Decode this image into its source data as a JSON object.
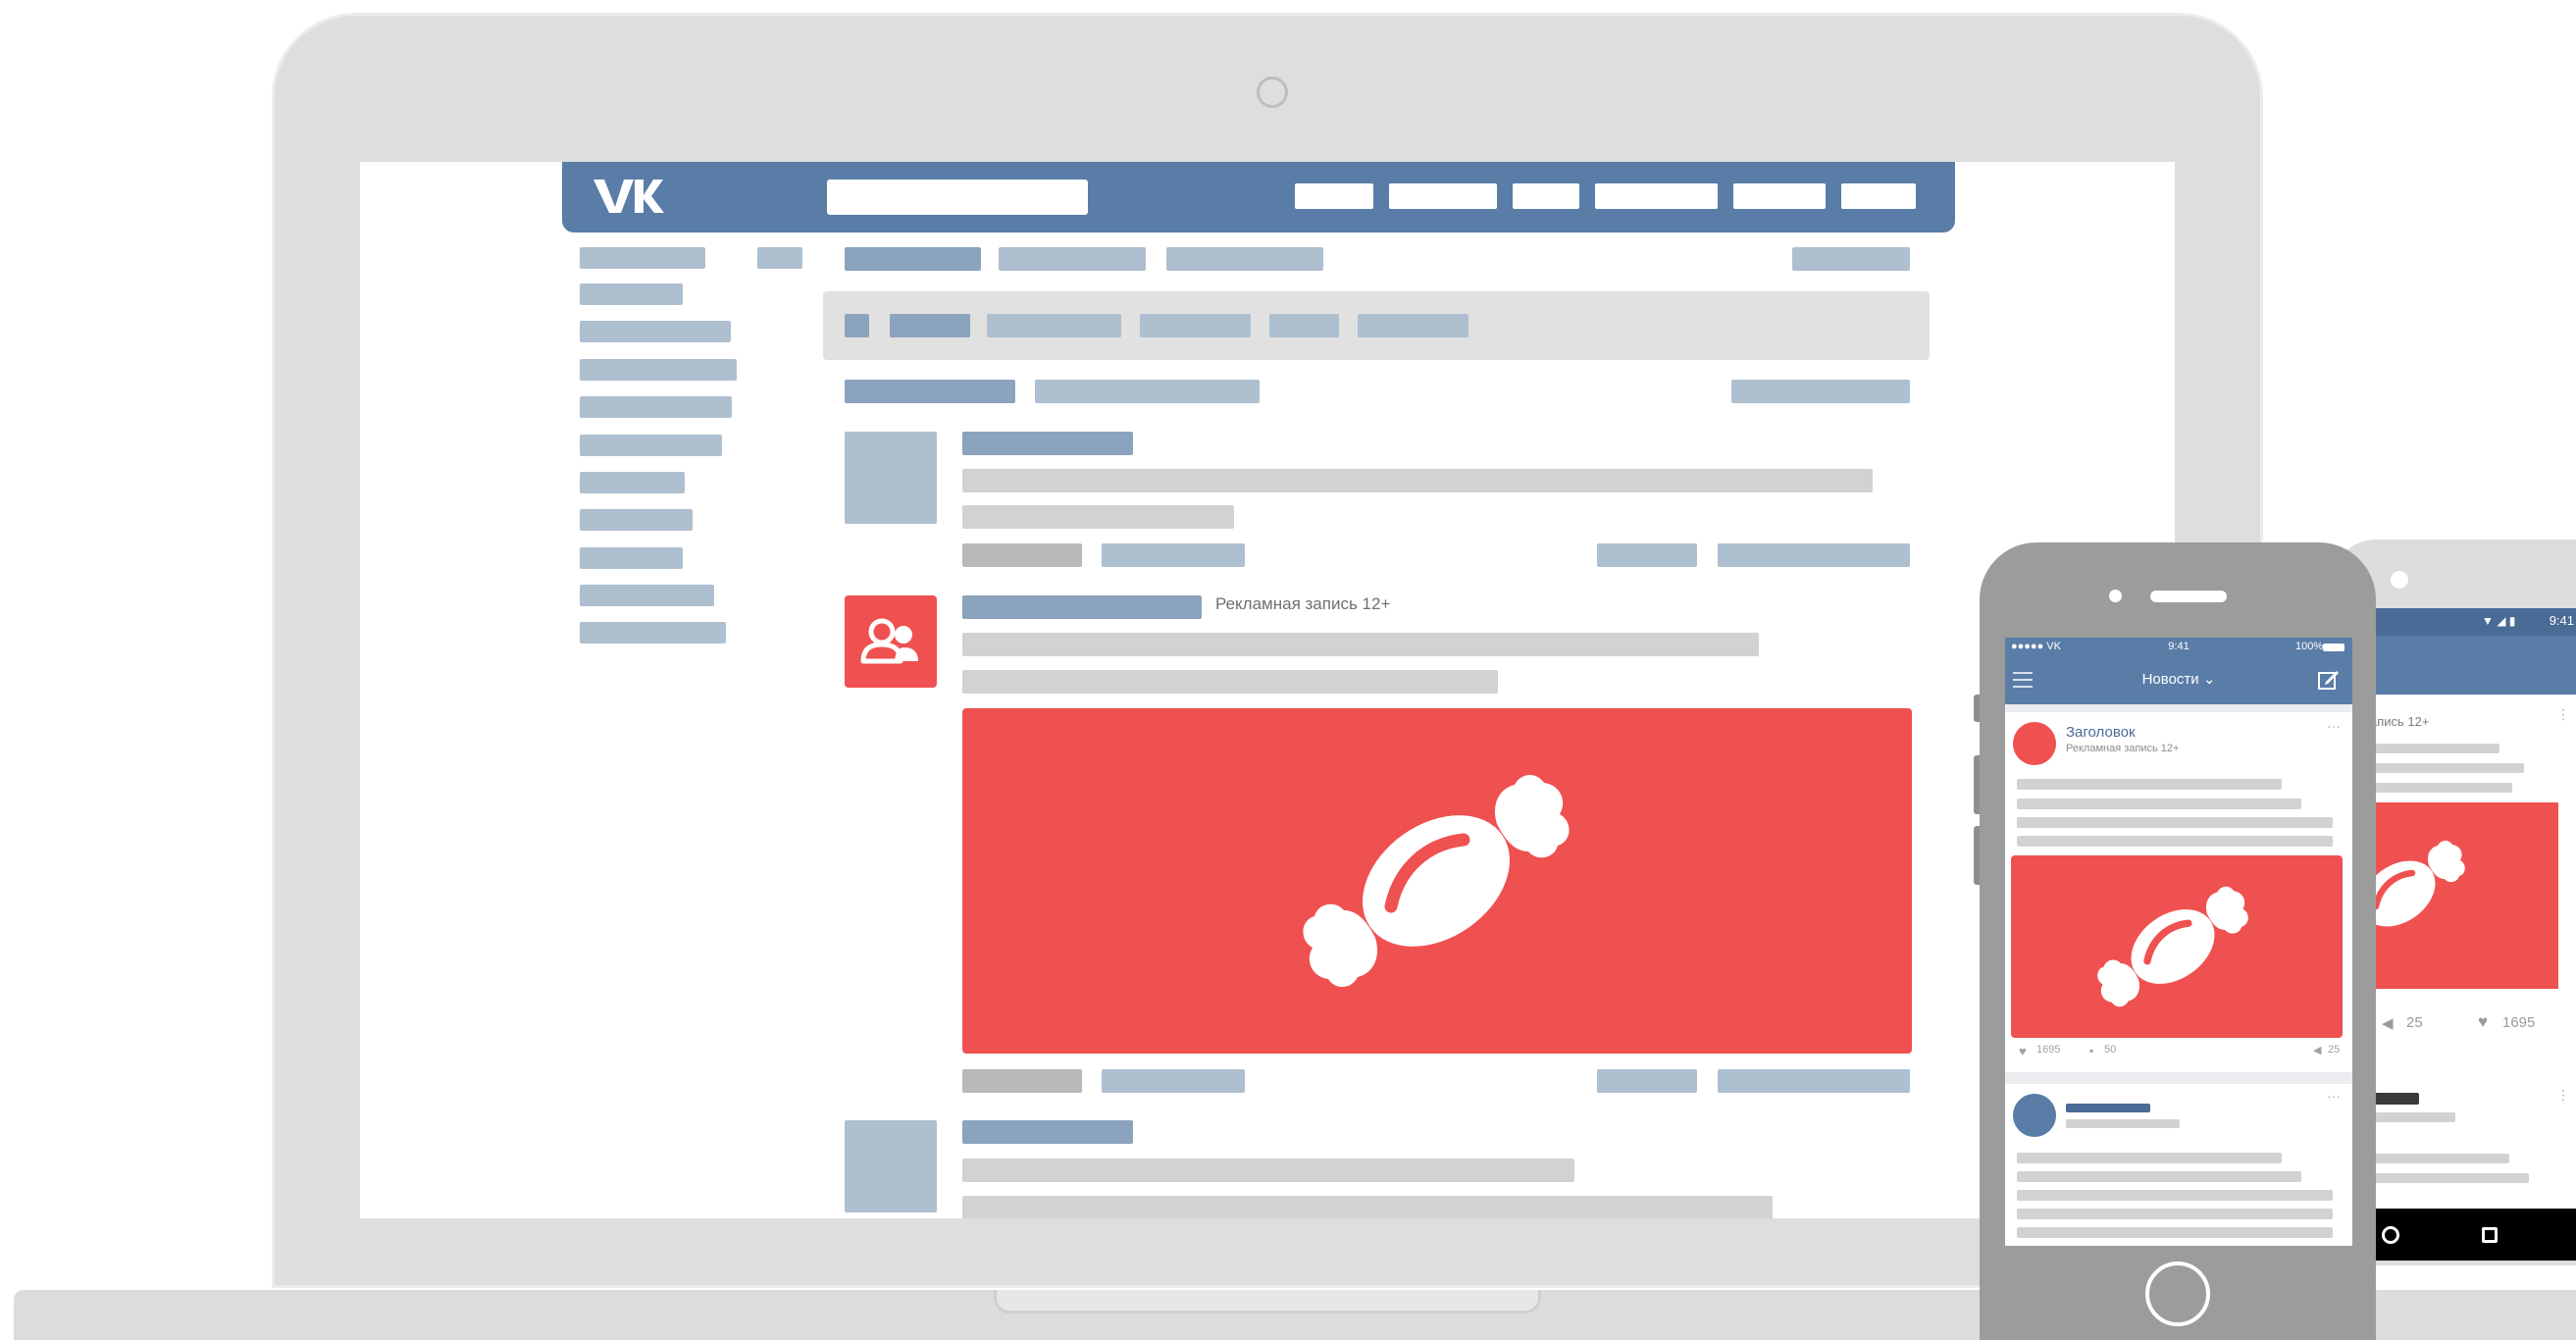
{
  "desktop": {
    "ad_label": "Рекламная запись 12+"
  },
  "iphone": {
    "status_left": "●●●●● VK",
    "status_time": "9:41",
    "status_battery": "100%",
    "nav_title": "Новости ⌄",
    "post": {
      "title": "Заголовок",
      "subtitle": "Рекламная запись 12+",
      "likes": "1695",
      "comments": "50",
      "shares": "25"
    }
  },
  "android": {
    "status_time": "9:41",
    "ad_label_partial": "запись 12+",
    "shares": "25",
    "likes": "1695"
  },
  "colors": {
    "vk_blue": "#5a7da8",
    "ad_red": "#ef5150",
    "placeholder_blue": "#aebfcf",
    "placeholder_gray": "#d2d2d2"
  },
  "icons": {
    "logo": "vk-logo",
    "ad_image": "candy-icon",
    "community_avatar": "people-icon"
  }
}
